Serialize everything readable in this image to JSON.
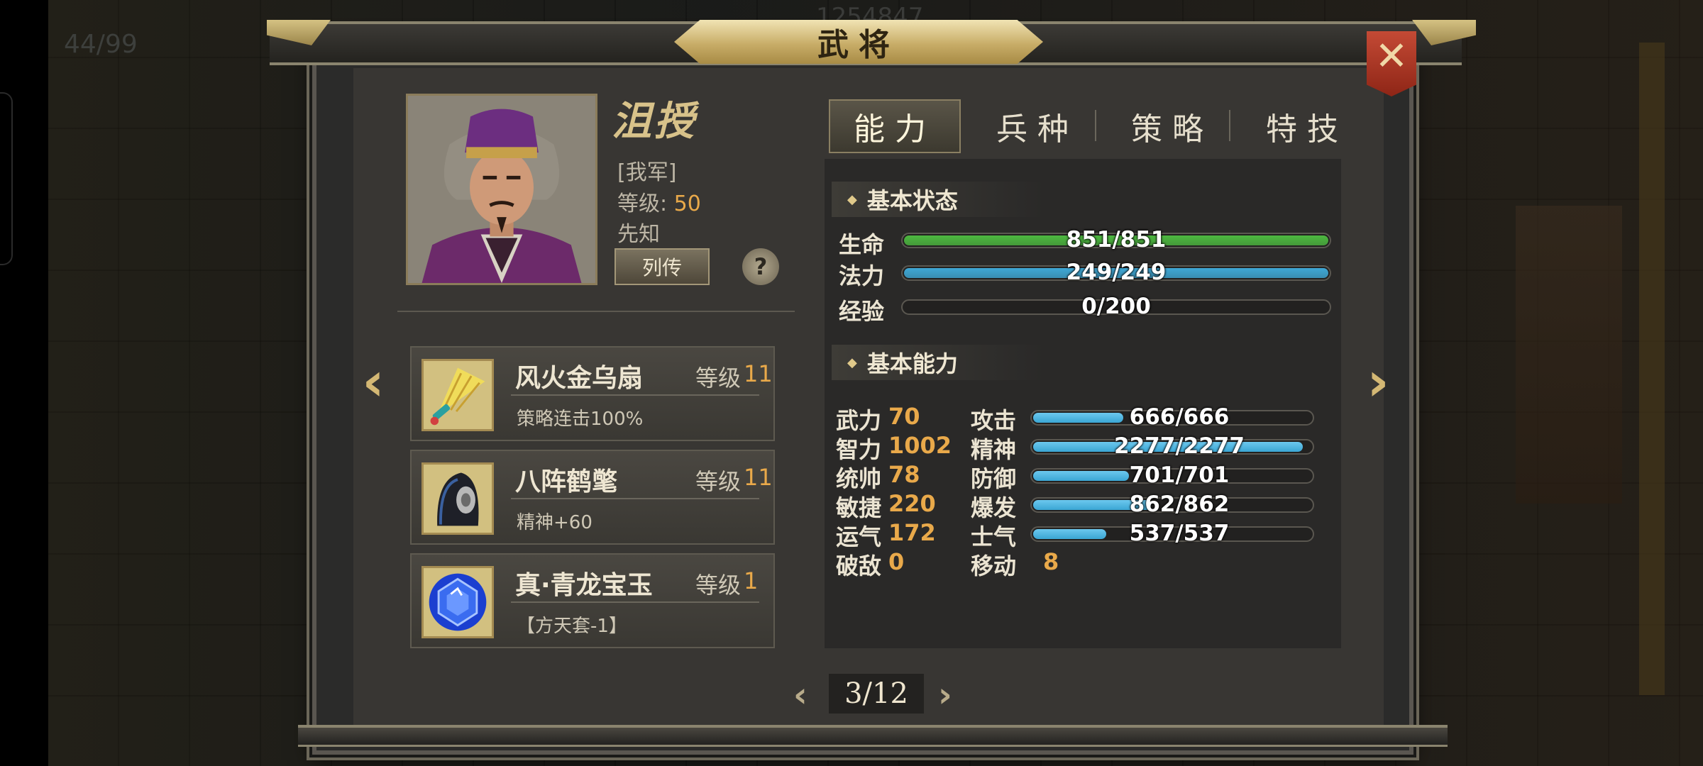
{
  "background": {
    "counter": "44/99",
    "score": "1254847"
  },
  "dialog": {
    "title": "武将",
    "close_icon": "close-x-icon"
  },
  "general": {
    "name": "沮授",
    "faction": "[我军]",
    "level_label": "等级:",
    "level": "50",
    "skill": "先知",
    "biography_button": "列传",
    "help_button": "?"
  },
  "tabs": [
    {
      "label": "能力",
      "active": true
    },
    {
      "label": "兵种",
      "active": false
    },
    {
      "label": "策略",
      "active": false
    },
    {
      "label": "特技",
      "active": false
    }
  ],
  "equipment": [
    {
      "name": "风火金乌扇",
      "level_label": "等级",
      "level": "11",
      "desc": "策略连击100%",
      "icon": "golden-fan-icon"
    },
    {
      "name": "八阵鹤氅",
      "level_label": "等级",
      "level": "11",
      "desc": "精神+60",
      "icon": "crane-cloak-icon"
    },
    {
      "name": "真·青龙宝玉",
      "level_label": "等级",
      "level": "1",
      "desc": "【方天套-1】",
      "icon": "blue-jade-icon"
    }
  ],
  "basic_status": {
    "heading": "基本状态",
    "rows": [
      {
        "label": "生命",
        "text": "851/851",
        "fraction": 1.0,
        "color": "#4db840"
      },
      {
        "label": "法力",
        "text": "249/249",
        "fraction": 1.0,
        "color": "#3fa8d6"
      },
      {
        "label": "经验",
        "text": "0/200",
        "fraction": 0.0,
        "color": "#e0b040"
      }
    ]
  },
  "basic_ability": {
    "heading": "基本能力",
    "attributes": [
      {
        "label": "武力",
        "value": "70"
      },
      {
        "label": "智力",
        "value": "1002"
      },
      {
        "label": "统帅",
        "value": "78"
      },
      {
        "label": "敏捷",
        "value": "220"
      },
      {
        "label": "运气",
        "value": "172"
      },
      {
        "label": "破敌",
        "value": "0"
      }
    ],
    "combat": [
      {
        "label": "攻击",
        "text": "666/666",
        "fraction": 0.33
      },
      {
        "label": "精神",
        "text": "2277/2277",
        "fraction": 0.97
      },
      {
        "label": "防御",
        "text": "701/701",
        "fraction": 0.35
      },
      {
        "label": "爆发",
        "text": "862/862",
        "fraction": 0.43
      },
      {
        "label": "士气",
        "text": "537/537",
        "fraction": 0.27
      }
    ],
    "move": {
      "label": "移动",
      "value": "8"
    },
    "bar_color": "#3aa6d4"
  },
  "pager": {
    "prev": "‹",
    "current": "3/12",
    "next": "›"
  },
  "nav": {
    "left": "‹",
    "right": "›"
  }
}
